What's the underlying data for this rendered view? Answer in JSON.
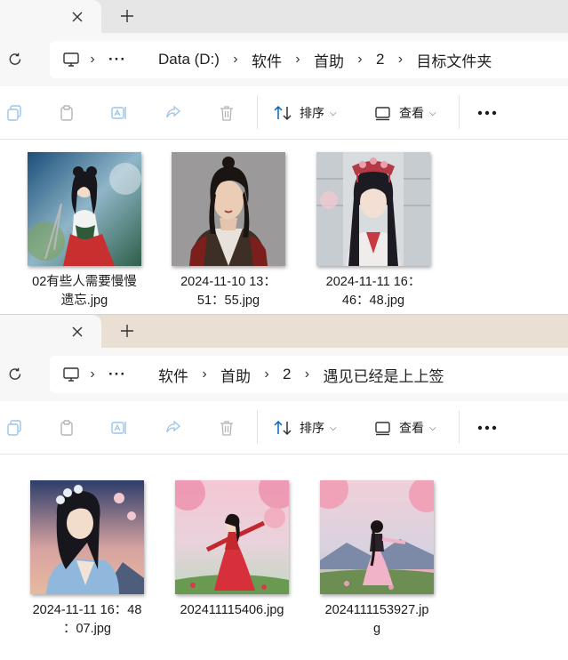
{
  "windows": [
    {
      "breadcrumbs": [
        "Data (D:)",
        "软件",
        "首助",
        "2",
        "目标文件夹"
      ],
      "files": [
        {
          "name": "02有些人需要慢慢遗忘.jpg",
          "line1": "02有些人需要慢慢",
          "line2": "遗忘.jpg"
        },
        {
          "name": "2024-11-10 13：51：55.jpg",
          "line1": "2024-11-10 13：",
          "line2": "51：55.jpg"
        },
        {
          "name": "2024-11-11 16：46：48.jpg",
          "line1": "2024-11-11 16：",
          "line2": "46：48.jpg"
        }
      ]
    },
    {
      "breadcrumbs": [
        "软件",
        "首助",
        "2",
        "遇见已经是上上签"
      ],
      "files": [
        {
          "name": "2024-11-11 16：48：07.jpg",
          "line1": "2024-11-11 16：48",
          "line2": "：07.jpg"
        },
        {
          "name": "202411115406.jpg",
          "line1": "202411115406.jpg",
          "line2": ""
        },
        {
          "name": "2024111153927.jpg",
          "line1": "2024111153927.jp",
          "line2": "g"
        }
      ]
    }
  ],
  "commands": {
    "sort_label": "排序",
    "view_label": "查看",
    "more_label": "..."
  },
  "icons": {
    "tab_close": "close-icon",
    "new_tab": "plus-icon",
    "refresh": "refresh-icon",
    "this_pc": "monitor-icon",
    "copy": "copy-icon",
    "paste": "paste-icon",
    "rename": "rename-icon",
    "share": "share-icon",
    "delete": "trash-icon",
    "sort": "sort-icon",
    "view": "view-icon"
  },
  "colors": {
    "accent": "#0067c0",
    "tabstrip_top": "#e6e6e6",
    "tabstrip_bottom": "#e9dfd3"
  }
}
